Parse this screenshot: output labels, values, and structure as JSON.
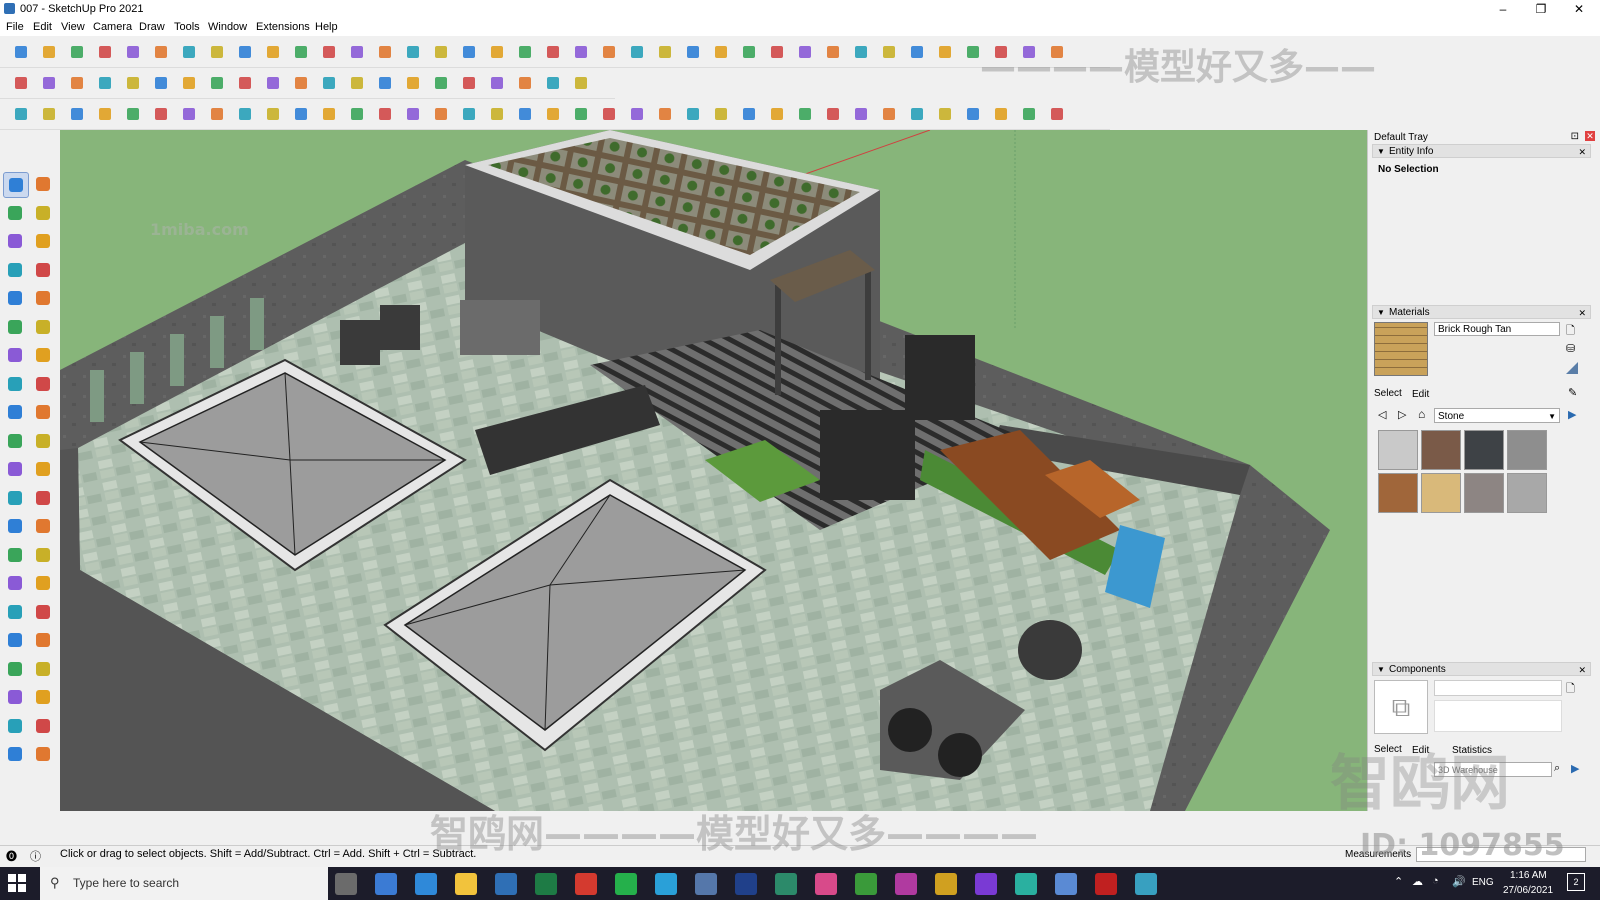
{
  "window": {
    "title": "007 - SketchUp Pro 2021",
    "minimize": "–",
    "maximize": "❐",
    "close": "✕"
  },
  "menu": [
    "File",
    "Edit",
    "View",
    "Camera",
    "Draw",
    "Tools",
    "Window",
    "Extensions",
    "Help"
  ],
  "tray": {
    "title": "Default Tray",
    "entity_info": {
      "header": "Entity Info",
      "selection": "No Selection"
    },
    "materials": {
      "header": "Materials",
      "name": "Brick Rough Tan",
      "tab_select": "Select",
      "tab_edit": "Edit",
      "library": "Stone",
      "swatch_colors": [
        "#c9c9c9",
        "#7a5a48",
        "#3e4246",
        "#8e8e8e",
        "#a0663a",
        "#d9b97a",
        "#8d8583",
        "#a8a8a8"
      ]
    },
    "components": {
      "header": "Components",
      "tab_select": "Select",
      "tab_edit": "Edit",
      "tab_statistics": "Statistics",
      "search_placeholder": "3D Warehouse"
    }
  },
  "status": {
    "hint": "Click or drag to select objects. Shift = Add/Subtract. Ctrl = Add. Shift + Ctrl = Subtract.",
    "measurements": "Measurements"
  },
  "taskbar": {
    "search_placeholder": "Type here to search",
    "language": "ENG",
    "time": "1:16 AM",
    "date": "27/06/2021",
    "notifications": "2"
  },
  "watermarks": {
    "top": "————模型好又多——",
    "bottom": "智鸥网————模型好又多————",
    "site": "1miba.com",
    "brand": "智鸥网",
    "id": "ID: 1097855"
  }
}
